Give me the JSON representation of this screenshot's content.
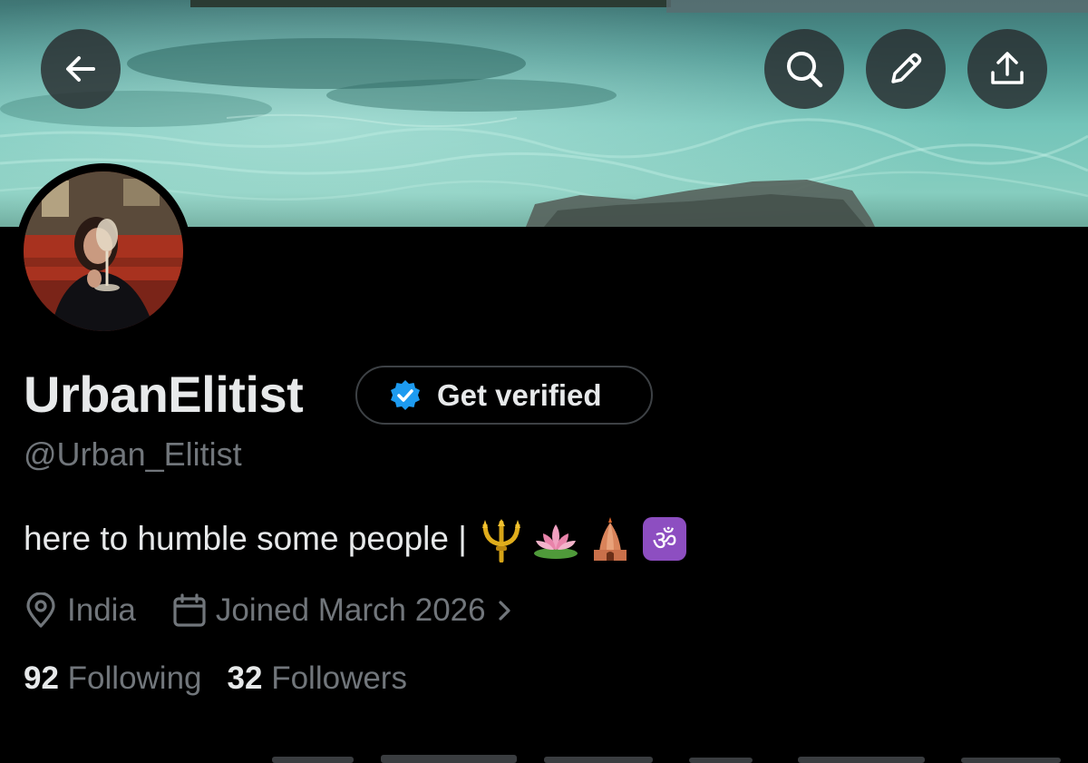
{
  "profile": {
    "display_name": "UrbanElitist",
    "handle": "@Urban_Elitist",
    "bio_text": "here to humble some people |",
    "bio_emojis": [
      "trident-emblem",
      "lotus",
      "hindu-temple",
      "om-symbol"
    ],
    "location": "India",
    "joined": "Joined March 2026",
    "following_count": "92",
    "following_label": "Following",
    "followers_count": "32",
    "followers_label": "Followers"
  },
  "verify": {
    "label": "Get verified"
  },
  "icons": {
    "back": "arrow-left-icon",
    "search": "search-icon",
    "edit": "pencil-icon",
    "share": "share-upload-icon",
    "location": "location-pin-icon",
    "calendar": "calendar-icon",
    "chevron": "chevron-right-icon",
    "verified": "verified-badge-icon"
  },
  "colors": {
    "background": "#000000",
    "primary_text": "#e7e9ea",
    "secondary_text": "#71767b",
    "verified_blue": "#1d9bf0",
    "button_border": "#3d4145"
  }
}
